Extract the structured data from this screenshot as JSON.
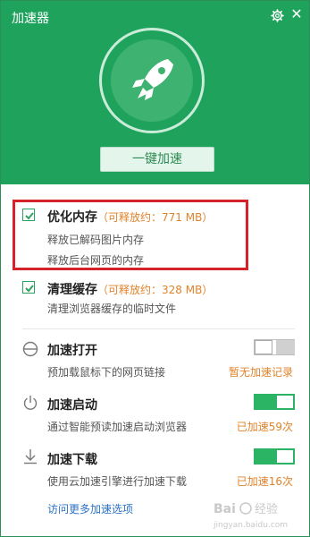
{
  "window": {
    "title": "加速器"
  },
  "hero": {
    "button_label": "一键加速"
  },
  "cleanup": [
    {
      "checked": true,
      "title": "优化内存",
      "extra": "（可释放约：771 MB）",
      "details": [
        "释放已解码图片内存",
        "释放后台网页的内存"
      ]
    },
    {
      "checked": true,
      "title": "清理缓存",
      "extra": "（可释放约：328 MB）",
      "details": [
        "清理浏览器缓存的临时文件"
      ]
    }
  ],
  "options": [
    {
      "icon": "half-circle-icon",
      "title": "加速打开",
      "subtitle": "预加载鼠标下的网页链接",
      "status": "暂无加速记录",
      "enabled": false
    },
    {
      "icon": "power-icon",
      "title": "加速启动",
      "subtitle": "通过智能预读加速启动浏览器",
      "status": "已加速59次",
      "enabled": true
    },
    {
      "icon": "download-icon",
      "title": "加速下载",
      "subtitle": "使用云加速引擎进行加速下载",
      "status": "已加速16次",
      "enabled": true
    }
  ],
  "footer": {
    "more_link": "访问更多加速选项"
  },
  "watermark": {
    "site": "jingyan.baidu.com"
  },
  "colors": {
    "header_green": "#1fa35c",
    "accent_orange": "#e0832a",
    "link_blue": "#2b73c7",
    "highlight_red": "#d4232a"
  }
}
